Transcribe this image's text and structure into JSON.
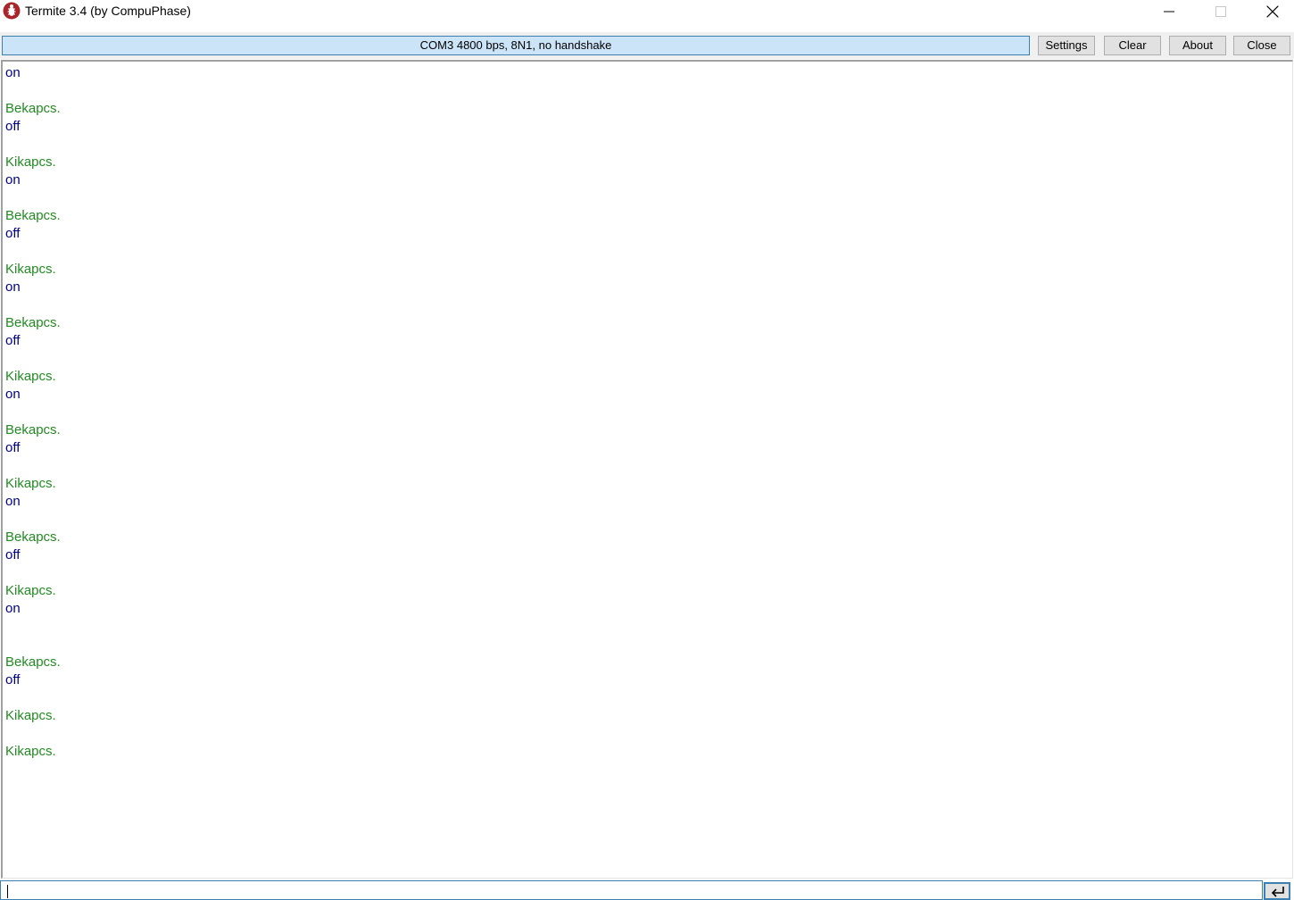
{
  "window": {
    "title": "Termite 3.4 (by CompuPhase)"
  },
  "toolbar": {
    "status": "COM3 4800 bps, 8N1, no handshake",
    "settings_label": "Settings",
    "clear_label": "Clear",
    "about_label": "About",
    "close_label": "Close"
  },
  "terminal": {
    "lines": [
      {
        "text": "on",
        "kind": "sent"
      },
      {
        "text": "Bekapcs.",
        "kind": "received"
      },
      {
        "text": "off",
        "kind": "sent"
      },
      {
        "text": "Kikapcs.",
        "kind": "received"
      },
      {
        "text": "on",
        "kind": "sent"
      },
      {
        "text": "Bekapcs.",
        "kind": "received"
      },
      {
        "text": "off",
        "kind": "sent"
      },
      {
        "text": "Kikapcs.",
        "kind": "received"
      },
      {
        "text": "on",
        "kind": "sent"
      },
      {
        "text": "Bekapcs.",
        "kind": "received"
      },
      {
        "text": "off",
        "kind": "sent"
      },
      {
        "text": "Kikapcs.",
        "kind": "received"
      },
      {
        "text": "on",
        "kind": "sent"
      },
      {
        "text": "Bekapcs.",
        "kind": "received"
      },
      {
        "text": "off",
        "kind": "sent"
      },
      {
        "text": "Kikapcs.",
        "kind": "received"
      },
      {
        "text": "on",
        "kind": "sent"
      },
      {
        "text": "Bekapcs.",
        "kind": "received"
      },
      {
        "text": "off",
        "kind": "sent"
      },
      {
        "text": "Kikapcs.",
        "kind": "received"
      },
      {
        "text": "on",
        "kind": "sent"
      },
      {
        "text": "Bekapcs.",
        "kind": "received"
      },
      {
        "text": "off",
        "kind": "sent"
      },
      {
        "text": "Kikapcs.",
        "kind": "received"
      },
      {
        "text": "Kikapcs.",
        "kind": "received"
      }
    ],
    "colors": {
      "received": "#228b22",
      "sent": "#00008b"
    }
  },
  "input": {
    "value": ""
  },
  "icons": {
    "app": "termite-app-icon",
    "minimize": "minimize-icon",
    "maximize": "maximize-icon",
    "close": "close-icon",
    "send": "enter-icon"
  }
}
